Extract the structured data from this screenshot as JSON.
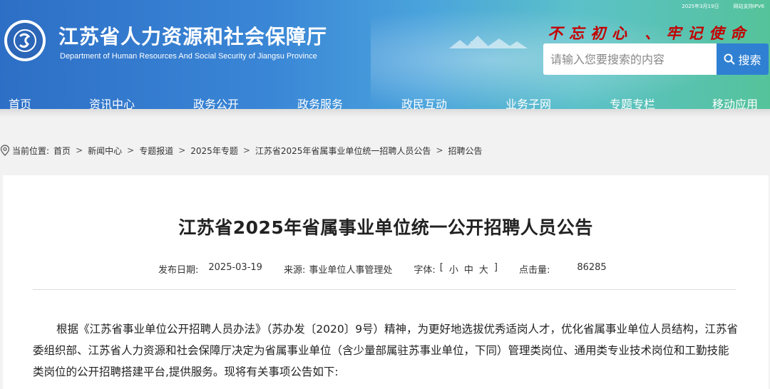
{
  "header": {
    "date": "2025年3月19日",
    "ipv6": "网站支持IPV6",
    "title": "江苏省人力资源和社会保障厅",
    "subtitle": "Department of Human Resources And Social Security of Jiangsu Province",
    "slogan": "不忘初心 、牢记使命",
    "search_placeholder": "请输入您要搜索的内容",
    "search_label": "搜索"
  },
  "nav": {
    "items": [
      "首页",
      "资讯中心",
      "政务公开",
      "政务服务",
      "政民互动",
      "业务子网",
      "专题专栏",
      "移动应用"
    ]
  },
  "breadcrumb": {
    "prefix": "当前位置:",
    "items": [
      "首页",
      "新闻中心",
      "专题报道",
      "2025年专题",
      "江苏省2025年省属事业单位统一招聘人员公告",
      "招聘公告"
    ]
  },
  "article": {
    "title": "江苏省2025年省属事业单位统一公开招聘人员公告",
    "meta": {
      "date_label": "发布日期:",
      "date": "2025-03-19",
      "source_label": "来源:",
      "source": "事业单位人事管理处",
      "font_label": "字体:",
      "font_open": "[",
      "font_small": "小",
      "font_medium": "中",
      "font_large": "大",
      "font_close": "]",
      "hits_label": "点击量:",
      "hits": "86285"
    },
    "paragraph": "根据《江苏省事业单位公开招聘人员办法》（苏办发〔2020〕9号）精神，为更好地选拔优秀适岗人才，优化省属事业单位人员结构，江苏省委组织部、江苏省人力资源和社会保障厅决定为省属事业单位（含少量部属驻苏事业单位，下同）管理类岗位、通用类专业技术岗位和工勤技能类岗位的公开招聘搭建平台,提供服务。现将有关事项公告如下:"
  }
}
